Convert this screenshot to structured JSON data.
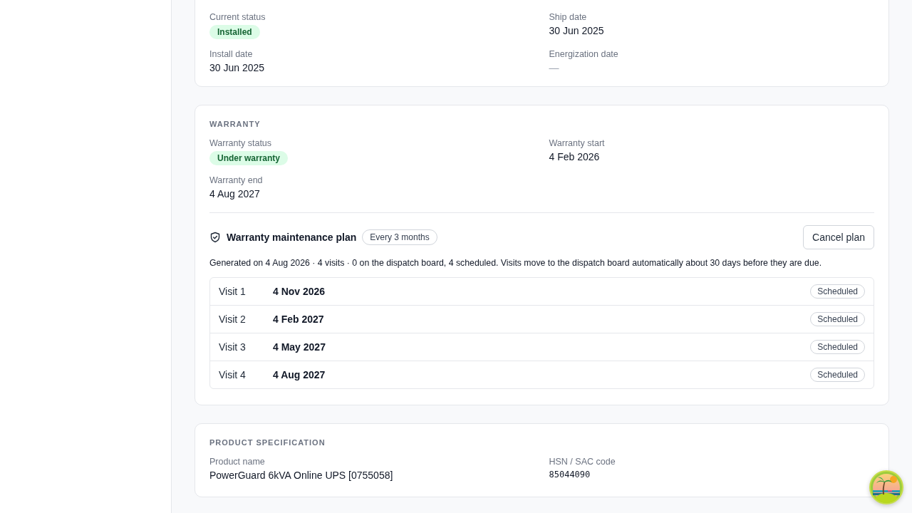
{
  "lifecycle": {
    "fields": [
      {
        "label": "Current status",
        "kind": "badge",
        "value": "Installed"
      },
      {
        "label": "Ship date",
        "kind": "text",
        "value": "30 Jun 2025"
      },
      {
        "label": "Install date",
        "kind": "text",
        "value": "30 Jun 2025"
      },
      {
        "label": "Energization date",
        "kind": "empty",
        "value": "—"
      }
    ]
  },
  "warranty": {
    "title": "WARRANTY",
    "fields": [
      {
        "label": "Warranty status",
        "kind": "badge",
        "value": "Under warranty"
      },
      {
        "label": "Warranty start",
        "kind": "text",
        "value": "4 Feb 2026"
      },
      {
        "label": "Warranty end",
        "kind": "text",
        "value": "4 Aug 2027"
      }
    ],
    "plan": {
      "title": "Warranty maintenance plan",
      "frequency": "Every 3 months",
      "action": "Cancel plan",
      "note": "Generated on 4 Aug 2026 · 4 visits · 0 on the dispatch board, 4 scheduled. Visits move to the dispatch board automatically about 30 days before they are due.",
      "visits": [
        {
          "name": "Visit 1",
          "date": "4 Nov 2026",
          "status": "Scheduled"
        },
        {
          "name": "Visit 2",
          "date": "4 Feb 2027",
          "status": "Scheduled"
        },
        {
          "name": "Visit 3",
          "date": "4 May 2027",
          "status": "Scheduled"
        },
        {
          "name": "Visit 4",
          "date": "4 Aug 2027",
          "status": "Scheduled"
        }
      ]
    }
  },
  "product": {
    "title": "PRODUCT SPECIFICATION",
    "fields": [
      {
        "label": "Product name",
        "kind": "text",
        "value": "PowerGuard 6kVA Online UPS [0755058]"
      },
      {
        "label": "HSN / SAC code",
        "kind": "mono",
        "value": "85044090"
      }
    ]
  }
}
